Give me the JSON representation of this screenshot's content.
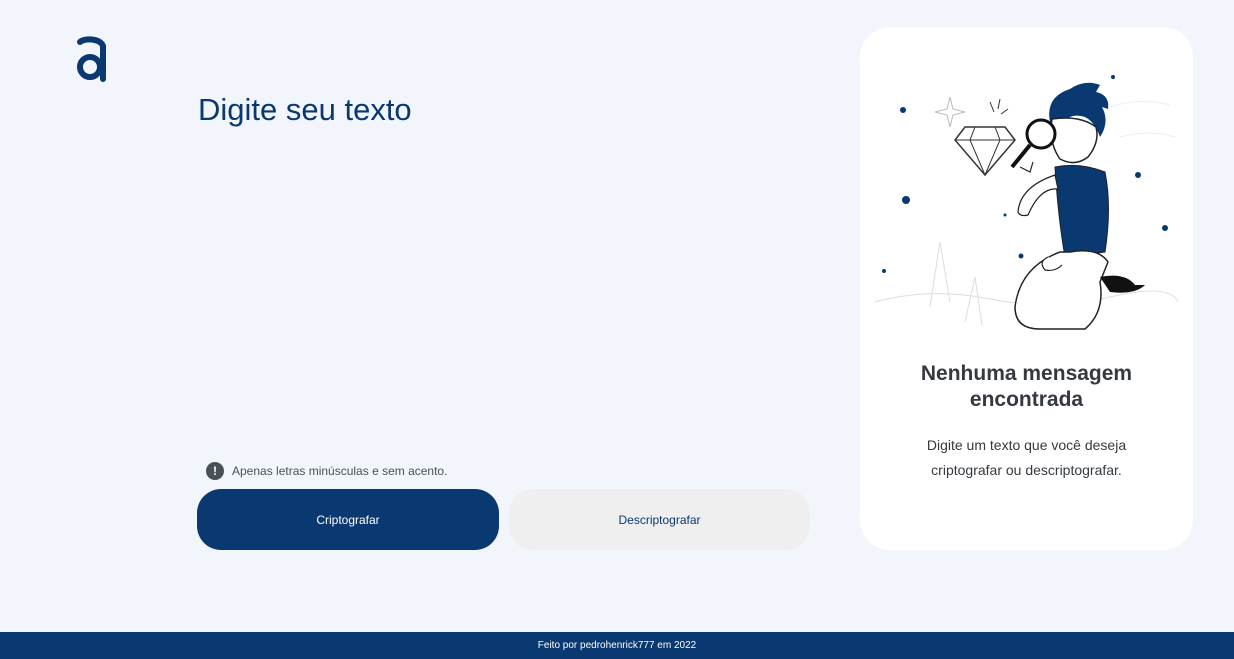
{
  "logo": {
    "icon": "alura-logo-icon"
  },
  "editor": {
    "placeholder": "Digite seu texto",
    "value": ""
  },
  "hint": {
    "icon": "exclamation-icon",
    "text": "Apenas letras minúsculas e sem acento."
  },
  "buttons": {
    "encrypt_label": "Criptografar",
    "decrypt_label": "Descriptografar"
  },
  "result_panel": {
    "illustration": "person-with-magnifier-illustration",
    "title": "Nenhuma mensagem encontrada",
    "description": "Digite um texto que você deseja criptografar ou descriptografar."
  },
  "footer": {
    "text": "Feito por pedrohenrick777 em 2022"
  },
  "colors": {
    "primary": "#0a3871",
    "background": "#f3f5fc",
    "card": "#ffffff",
    "secondary_button": "#efefef"
  }
}
